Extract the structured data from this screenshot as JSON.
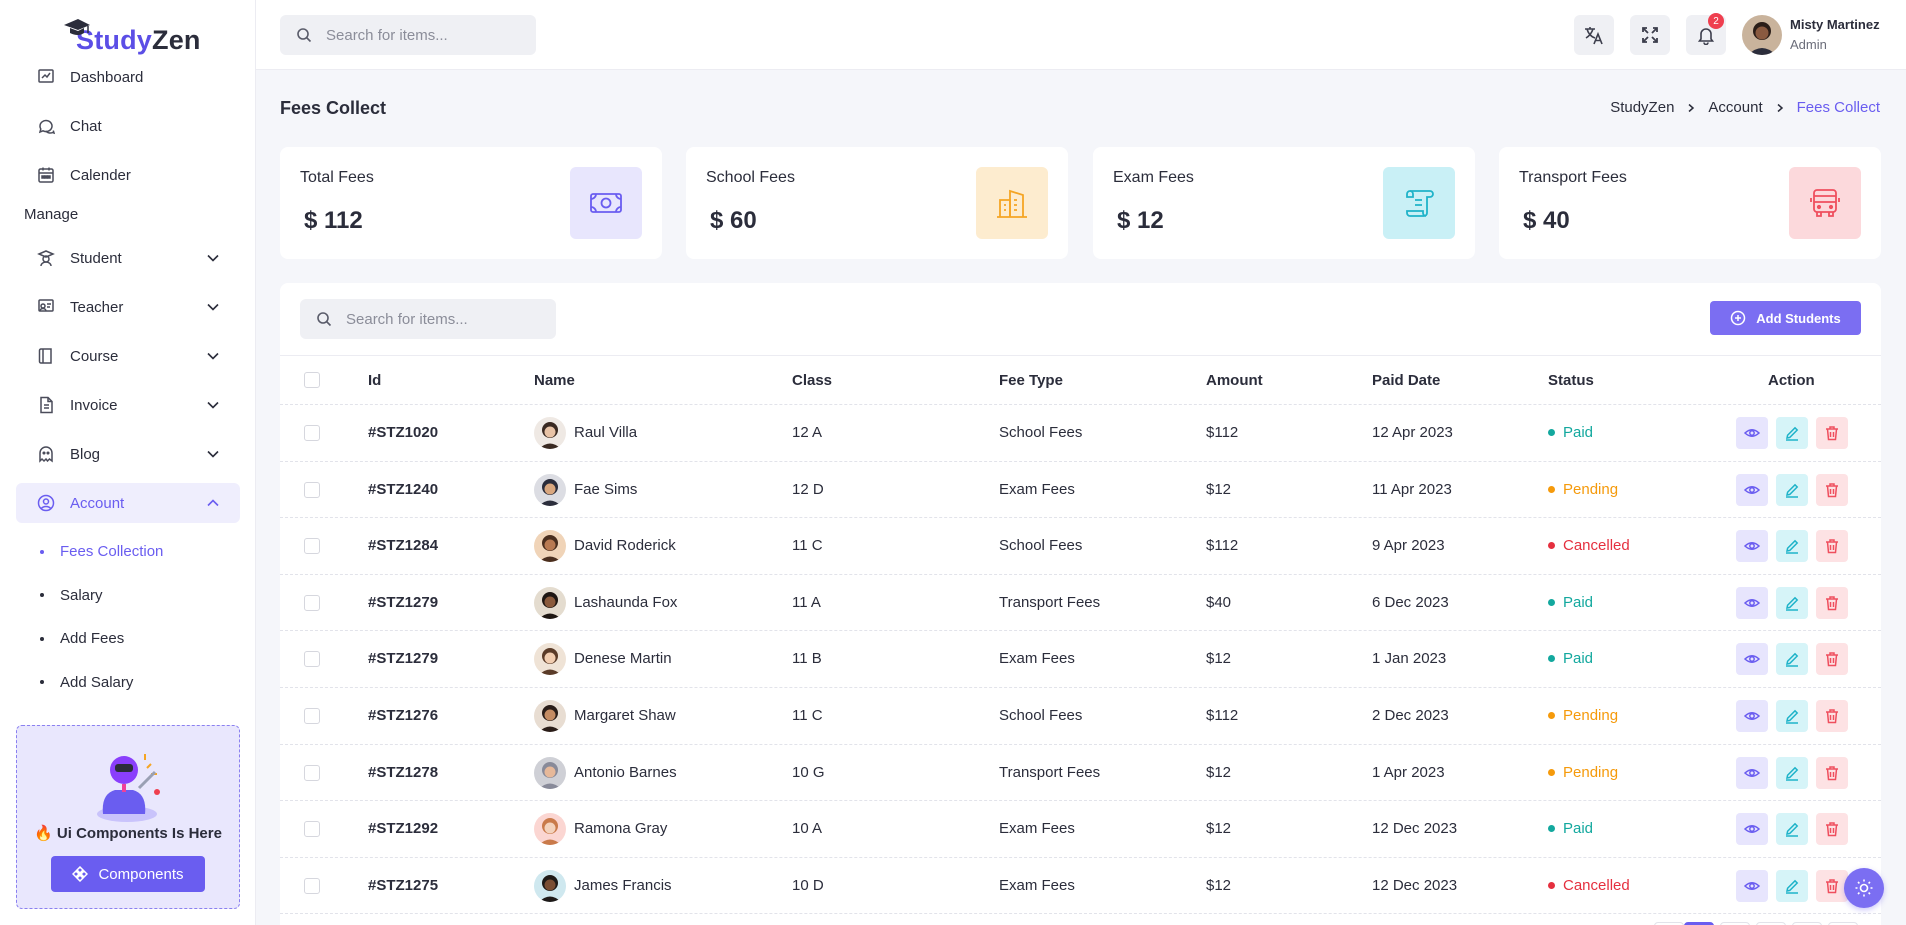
{
  "app": {
    "logo_prefix": "Study",
    "logo_suffix": "Zen"
  },
  "sidebar": {
    "items_top": [
      {
        "label": "Dashboard",
        "icon": "dashboard-icon"
      },
      {
        "label": "Chat",
        "icon": "chat-icon"
      },
      {
        "label": "Calender",
        "icon": "calendar-icon"
      }
    ],
    "section_manage": "Manage",
    "items_manage": [
      {
        "label": "Student",
        "icon": "student-icon",
        "expanded": false
      },
      {
        "label": "Teacher",
        "icon": "teacher-icon",
        "expanded": false
      },
      {
        "label": "Course",
        "icon": "course-icon",
        "expanded": false
      },
      {
        "label": "Invoice",
        "icon": "invoice-icon",
        "expanded": false
      },
      {
        "label": "Blog",
        "icon": "blog-icon",
        "expanded": false
      },
      {
        "label": "Account",
        "icon": "account-icon",
        "expanded": true,
        "active": true
      }
    ],
    "account_sub": [
      {
        "label": "Fees Collection",
        "active": true
      },
      {
        "label": "Salary",
        "active": false
      },
      {
        "label": "Add Fees",
        "active": false
      },
      {
        "label": "Add Salary",
        "active": false
      }
    ],
    "promo": {
      "text": "🔥 Ui Components Is Here",
      "button": "Components"
    }
  },
  "header": {
    "search_placeholder": "Search for items...",
    "notification_count": "2",
    "user": {
      "name": "Misty Martinez",
      "role": "Admin"
    }
  },
  "page": {
    "title": "Fees Collect",
    "breadcrumb": [
      "StudyZen",
      "Account",
      "Fees Collect"
    ]
  },
  "stats": [
    {
      "label": "Total Fees",
      "value": "$ 112",
      "icon": "money-icon",
      "color": "#6a5df0",
      "bg": "#e8e6fd"
    },
    {
      "label": "School Fees",
      "value": "$ 60",
      "icon": "building-icon",
      "color": "#f5a524",
      "bg": "#fdeccf"
    },
    {
      "label": "Exam Fees",
      "value": "$ 12",
      "icon": "scroll-icon",
      "color": "#1fb3c9",
      "bg": "#c9f0f6"
    },
    {
      "label": "Transport Fees",
      "value": "$ 40",
      "icon": "bus-icon",
      "color": "#ef4f5e",
      "bg": "#fcd9dc"
    }
  ],
  "table": {
    "search_placeholder": "Search for items...",
    "add_button": "Add Students",
    "columns": [
      "Id",
      "Name",
      "Class",
      "Fee Type",
      "Amount",
      "Paid Date",
      "Status",
      "Action"
    ],
    "status_colors": {
      "Paid": "#13a89e",
      "Pending": "#f59a0b",
      "Cancelled": "#e5303f"
    },
    "rows": [
      {
        "id": "#STZ1020",
        "name": "Raul Villa",
        "class": "12 A",
        "fee_type": "School Fees",
        "amount": "$112",
        "date": "12 Apr 2023",
        "status": "Paid"
      },
      {
        "id": "#STZ1240",
        "name": "Fae Sims",
        "class": "12 D",
        "fee_type": "Exam Fees",
        "amount": "$12",
        "date": "11 Apr 2023",
        "status": "Pending"
      },
      {
        "id": "#STZ1284",
        "name": "David Roderick",
        "class": "11 C",
        "fee_type": "School Fees",
        "amount": "$112",
        "date": "9 Apr 2023",
        "status": "Cancelled"
      },
      {
        "id": "#STZ1279",
        "name": "Lashaunda Fox",
        "class": "11 A",
        "fee_type": "Transport Fees",
        "amount": "$40",
        "date": "6 Dec 2023",
        "status": "Paid"
      },
      {
        "id": "#STZ1279",
        "name": "Denese Martin",
        "class": "11 B",
        "fee_type": "Exam Fees",
        "amount": "$12",
        "date": "1 Jan 2023",
        "status": "Paid"
      },
      {
        "id": "#STZ1276",
        "name": "Margaret Shaw",
        "class": "11 C",
        "fee_type": "School Fees",
        "amount": "$112",
        "date": "2 Dec 2023",
        "status": "Pending"
      },
      {
        "id": "#STZ1278",
        "name": "Antonio Barnes",
        "class": "10 G",
        "fee_type": "Transport Fees",
        "amount": "$12",
        "date": "1 Apr 2023",
        "status": "Pending"
      },
      {
        "id": "#STZ1292",
        "name": "Ramona Gray",
        "class": "10 A",
        "fee_type": "Exam Fees",
        "amount": "$12",
        "date": "12 Dec 2023",
        "status": "Paid"
      },
      {
        "id": "#STZ1275",
        "name": "James Francis",
        "class": "10 D",
        "fee_type": "Exam Fees",
        "amount": "$12",
        "date": "12 Dec 2023",
        "status": "Cancelled"
      }
    ]
  }
}
